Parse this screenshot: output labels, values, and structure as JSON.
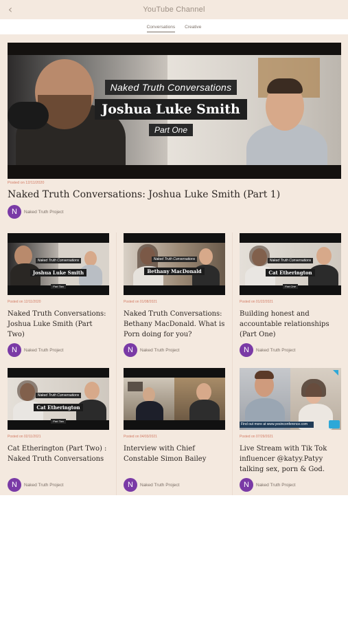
{
  "header": {
    "title": "YouTube Channel",
    "back_icon": "chevron-left-icon"
  },
  "tabs": [
    {
      "label": "Conversations",
      "active": true
    },
    {
      "label": "Creative",
      "active": false
    }
  ],
  "featured": {
    "thumb": {
      "tag": "Naked Truth Conversations",
      "name": "Joshua Luke Smith",
      "part": "Part One"
    },
    "date": "Posted on 12/11/2020",
    "title": "Naked Truth Conversations: Joshua Luke Smith (Part 1)",
    "author": {
      "initial": "N",
      "name": "Naked Truth Project"
    }
  },
  "videos": [
    {
      "thumb": {
        "tag": "Naked Truth Conversations",
        "name": "Joshua Luke Smith",
        "part": "Part Two"
      },
      "date": "Posted on 12/11/2020",
      "title": "Naked Truth Conversations: Joshua Luke Smith (Part Two)",
      "author": {
        "initial": "N",
        "name": "Naked Truth Project"
      }
    },
    {
      "thumb": {
        "tag": "Naked Truth Conversations",
        "name": "Bethany MacDonald",
        "part": ""
      },
      "date": "Posted on 01/08/2021",
      "title": "Naked Truth Conversations: Bethany MacDonald. What is Porn doing for you?",
      "author": {
        "initial": "N",
        "name": "Naked Truth Project"
      }
    },
    {
      "thumb": {
        "tag": "Naked Truth Conversations",
        "name": "Cat Etherington",
        "part": "Part One"
      },
      "date": "Posted on 01/22/2021",
      "title": "Building honest and accountable relationships (Part One)",
      "author": {
        "initial": "N",
        "name": "Naked Truth Project"
      }
    },
    {
      "thumb": {
        "tag": "Naked Truth Conversations",
        "name": "Cat Etherington",
        "part": "Part Two"
      },
      "date": "Posted on 02/11/2021",
      "title": "Cat Etherington (Part Two) : Naked Truth Conversations",
      "author": {
        "initial": "N",
        "name": "Naked Truth Project"
      }
    },
    {
      "thumb": {
        "tag": "",
        "name": "",
        "part": ""
      },
      "date": "Posted on 04/03/2021",
      "title": "Interview with Chief Constable Simon Bailey",
      "author": {
        "initial": "N",
        "name": "Naked Truth Project"
      }
    },
    {
      "thumb": {
        "tag": "",
        "name": "",
        "part": "Find out more at www.yesinconference.com"
      },
      "date": "Posted on 07/29/2021",
      "title": "Live Stream with Tik Tok influencer @katyy.Patyy talking sex, porn & God.",
      "author": {
        "initial": "N",
        "name": "Naked Truth Project"
      }
    }
  ],
  "colors": {
    "background": "#f4e9df",
    "accent_date": "#d27a63",
    "avatar": "#7a3aa6",
    "text": "#2b2522"
  }
}
